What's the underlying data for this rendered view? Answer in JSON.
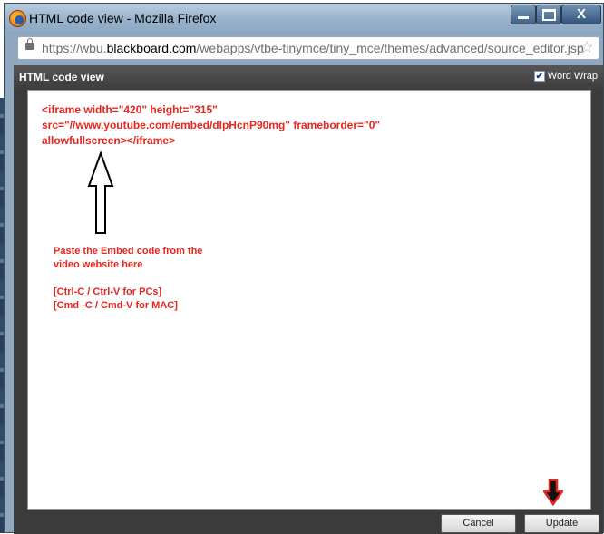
{
  "window": {
    "title": "HTML code view - Mozilla Firefox",
    "buttons": {
      "minimize": "minimize-icon",
      "maximize": "maximize-icon",
      "close": "X"
    }
  },
  "urlbar": {
    "prefix": "https://wbu.",
    "domain": "blackboard.com",
    "suffix": "/webapps/vtbe-tinymce/tiny_mce/themes/advanced/source_editor.jsp",
    "star": "☆"
  },
  "dialog": {
    "title": "HTML code view",
    "word_wrap_label": "Word Wrap",
    "word_wrap_checked": true,
    "code_lines": [
      "<iframe width=\"420\" height=\"315\"",
      "src=\"//www.youtube.com/embed/dIpHcnP90mg\" frameborder=\"0\"",
      "allowfullscreen></iframe>"
    ],
    "instructions": [
      "Paste the Embed code from the",
      "video website here",
      "[Ctrl-C / Ctrl-V for PCs]",
      "[Cmd -C / Cmd-V for MAC]"
    ],
    "cancel_label": "Cancel",
    "update_label": "Update"
  },
  "colors": {
    "annotation_red": "#e8251f",
    "dialog_bg": "#3b3b3b",
    "editor_bg": "#ffffff"
  }
}
